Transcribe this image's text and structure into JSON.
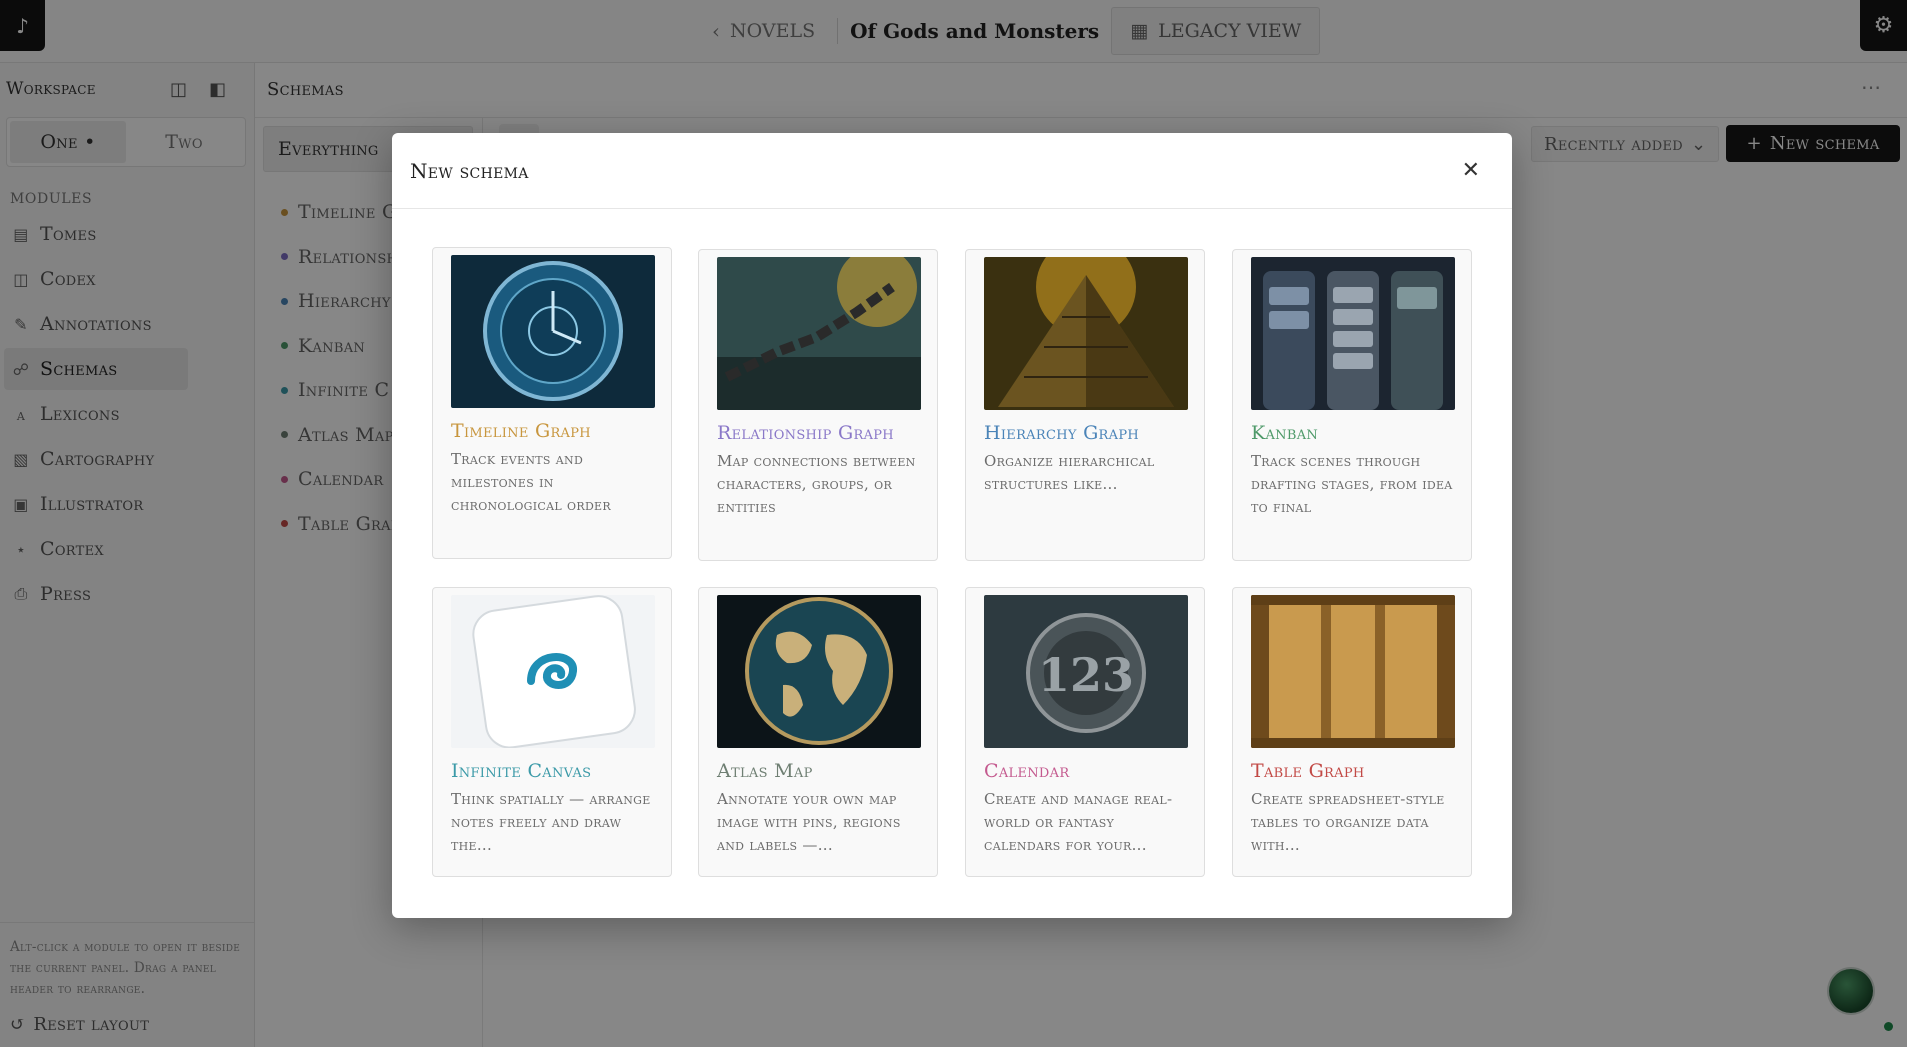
{
  "topbar": {
    "back_label": "NOVELS",
    "book_title": "Of Gods and Monsters",
    "legacy_label": "LEGACY VIEW"
  },
  "sidebar": {
    "workspace_label": "Workspace",
    "toggle": {
      "one": "One •",
      "two": "Two"
    },
    "modules_label": "MODULES",
    "items": [
      {
        "label": "Tomes",
        "icon": "file-icon"
      },
      {
        "label": "Codex",
        "icon": "book-icon"
      },
      {
        "label": "Annotations",
        "icon": "note-icon"
      },
      {
        "label": "Schemas",
        "icon": "schema-icon"
      },
      {
        "label": "Lexicons",
        "icon": "translate-icon"
      },
      {
        "label": "Cartography",
        "icon": "map-icon"
      },
      {
        "label": "Illustrator",
        "icon": "image-icon"
      },
      {
        "label": "Cortex",
        "icon": "network-icon"
      },
      {
        "label": "Press",
        "icon": "printer-icon"
      }
    ],
    "hint": "Alt-click a module to open it beside the current panel. Drag a panel header to rearrange.",
    "reset_label": "Reset layout"
  },
  "panel": {
    "title": "Schemas",
    "filter_label": "Everything",
    "sort_label": "Recently added",
    "new_button": "New schema",
    "schemas": [
      {
        "label": "Timeline G",
        "color": "#c8963e"
      },
      {
        "label": "Relationsh",
        "color": "#7d6fc4"
      },
      {
        "label": "Hierarchy",
        "color": "#4b84b8"
      },
      {
        "label": "Kanban",
        "color": "#4f9a6a"
      },
      {
        "label": "Infinite C",
        "color": "#3c9aa8"
      },
      {
        "label": "Atlas Map",
        "color": "#6f7f73"
      },
      {
        "label": "Calendar",
        "color": "#c45a8f"
      },
      {
        "label": "Table Grap",
        "color": "#c24a46"
      }
    ]
  },
  "modal": {
    "title": "New schema",
    "cards": [
      {
        "title": "Timeline Graph",
        "color": "#c8963e",
        "desc": "Track events and milestones in chronological order"
      },
      {
        "title": "Relationship Graph",
        "color": "#8a78c8",
        "desc": "Map connections between characters, groups, or entities"
      },
      {
        "title": "Hierarchy Graph",
        "color": "#4b84b8",
        "desc": "Organize hierarchical structures like..."
      },
      {
        "title": "Kanban",
        "color": "#4f9a6a",
        "desc": "Track scenes through drafting stages, from idea to final"
      },
      {
        "title": "Infinite Canvas",
        "color": "#3c9aa8",
        "desc": "Think spatially — arrange notes freely and draw the..."
      },
      {
        "title": "Atlas Map",
        "color": "#6f7f73",
        "desc": "Annotate your own map image with pins, regions and labels —..."
      },
      {
        "title": "Calendar",
        "color": "#c45a8f",
        "desc": "Create and manage real-world or fantasy calendars for your..."
      },
      {
        "title": "Table Graph",
        "color": "#c24a46",
        "desc": "Create spreadsheet-style tables to organize data with..."
      }
    ]
  }
}
